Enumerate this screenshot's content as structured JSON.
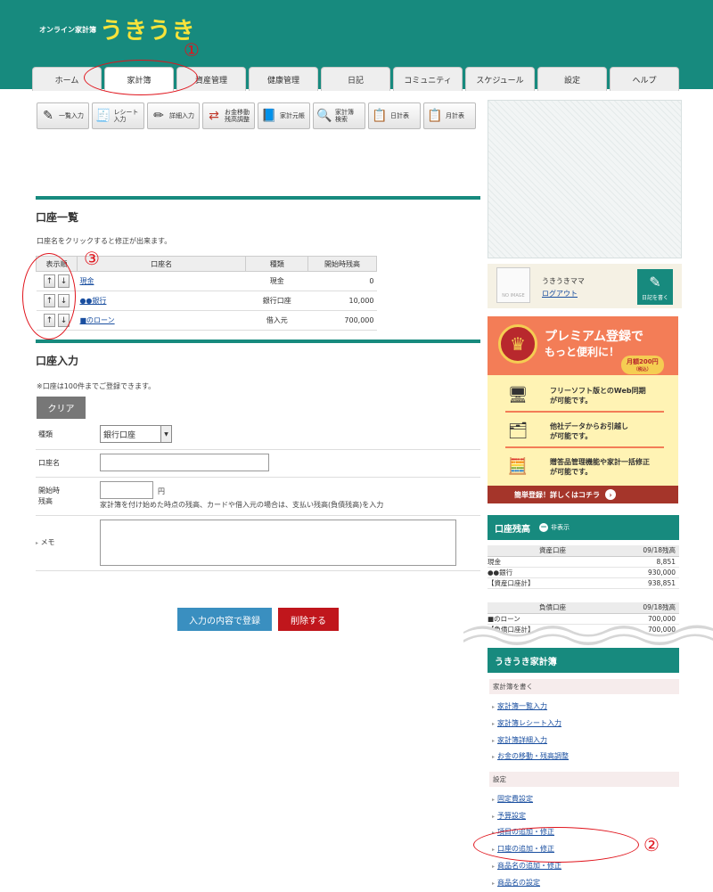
{
  "header": {
    "brand_small": "オンライン家計簿",
    "brand_large": "うきうき"
  },
  "tabs": [
    "ホーム",
    "家計簿",
    "資産管理",
    "健康管理",
    "日記",
    "コミュニティ",
    "スケジュール",
    "設定",
    "ヘルプ"
  ],
  "toolbar": [
    {
      "label": "一覧入力",
      "icon": "list-pencil-icon"
    },
    {
      "label": "レシート入力",
      "icon": "receipt-icon"
    },
    {
      "label": "詳細入力",
      "icon": "detail-pencil-icon"
    },
    {
      "label": "お金移動\n残高調整",
      "icon": "transfer-arrows-icon"
    },
    {
      "label": "家計元帳",
      "icon": "ledger-book-icon"
    },
    {
      "label": "家計簿\n検索",
      "icon": "magnifier-icon"
    },
    {
      "label": "日計表",
      "icon": "daily-sheet-icon"
    },
    {
      "label": "月計表",
      "icon": "monthly-sheet-icon"
    }
  ],
  "account_list": {
    "title": "口座一覧",
    "note": "口座名をクリックすると修正が出来ます。",
    "headers": [
      "表示順",
      "口座名",
      "種類",
      "開始時残高"
    ],
    "rows": [
      {
        "name": "現金",
        "type": "現金",
        "balance": "0"
      },
      {
        "name": "●●銀行",
        "type": "銀行口座",
        "balance": "10,000"
      },
      {
        "name": "■のローン",
        "type": "借入元",
        "balance": "700,000"
      }
    ]
  },
  "account_form": {
    "title": "口座入力",
    "note": "※口座は100件までご登録できます。",
    "clear_label": "クリア",
    "type_label": "種類",
    "type_value": "銀行口座",
    "name_label": "口座名",
    "name_value": "",
    "start_label_1": "開始時",
    "start_label_2": "残高",
    "start_value": "",
    "yen": "円",
    "help": "家計簿を付け始めた時点の残高、カードや借入元の場合は、支払い残高(負債残高)を入力",
    "memo_label": "メモ",
    "memo_value": "",
    "submit_label": "入力の内容で登録",
    "delete_label": "削除する"
  },
  "user": {
    "noimage": "NO IMAGE",
    "name": "うきうきママ",
    "logout": "ログアウト",
    "write_diary": "日記を書く"
  },
  "promo": {
    "title": "プレミアム登録で",
    "subtitle": "もっと便利に！",
    "price": "月額200円",
    "price_note": "（税込）",
    "features": [
      {
        "text": "フリーソフト版とのWeb同期\nが可能です。",
        "icon": "monitor-icon"
      },
      {
        "text": "他社データからお引越し\nが可能です。",
        "icon": "file-folder-icon"
      },
      {
        "text": "贈答品管理機能や家計一括修正\nが可能です。",
        "icon": "calculator-icon"
      }
    ],
    "footer": "簡単登録！詳しくはコチラ"
  },
  "balance": {
    "title": "口座残高",
    "hide_label": "非表示",
    "asset_header": [
      "資産口座",
      "09/18残高"
    ],
    "asset_rows": [
      {
        "name": "現金",
        "value": "8,851"
      },
      {
        "name": "●●銀行",
        "value": "930,000"
      },
      {
        "name": "【資産口座計】",
        "value": "938,851"
      }
    ],
    "debt_header": [
      "負債口座",
      "09/18残高"
    ],
    "debt_rows": [
      {
        "name": "■のローン",
        "value": "700,000"
      },
      {
        "name": "【負債口座計】",
        "value": "700,000"
      }
    ]
  },
  "side_menu": {
    "title": "うきうき家計簿",
    "group1": "家計簿を書く",
    "group1_links": [
      "家計簿一覧入力",
      "家計簿レシート入力",
      "家計簿詳細入力",
      "お金の移動・残高調整"
    ],
    "group2": "設定",
    "group2_links": [
      "固定費設定",
      "予算設定",
      "項目の追加・修正",
      "口座の追加・修正",
      "商品名の追加・修正",
      "商品名の設定"
    ]
  },
  "annotations": [
    "①",
    "②",
    "③"
  ],
  "colors": {
    "brand": "#178a7e",
    "brand_yellow": "#f7e33a",
    "annotation": "#e0141c",
    "submit": "#3a8fc0",
    "delete": "#c0161c",
    "promo": "#f37d57"
  }
}
